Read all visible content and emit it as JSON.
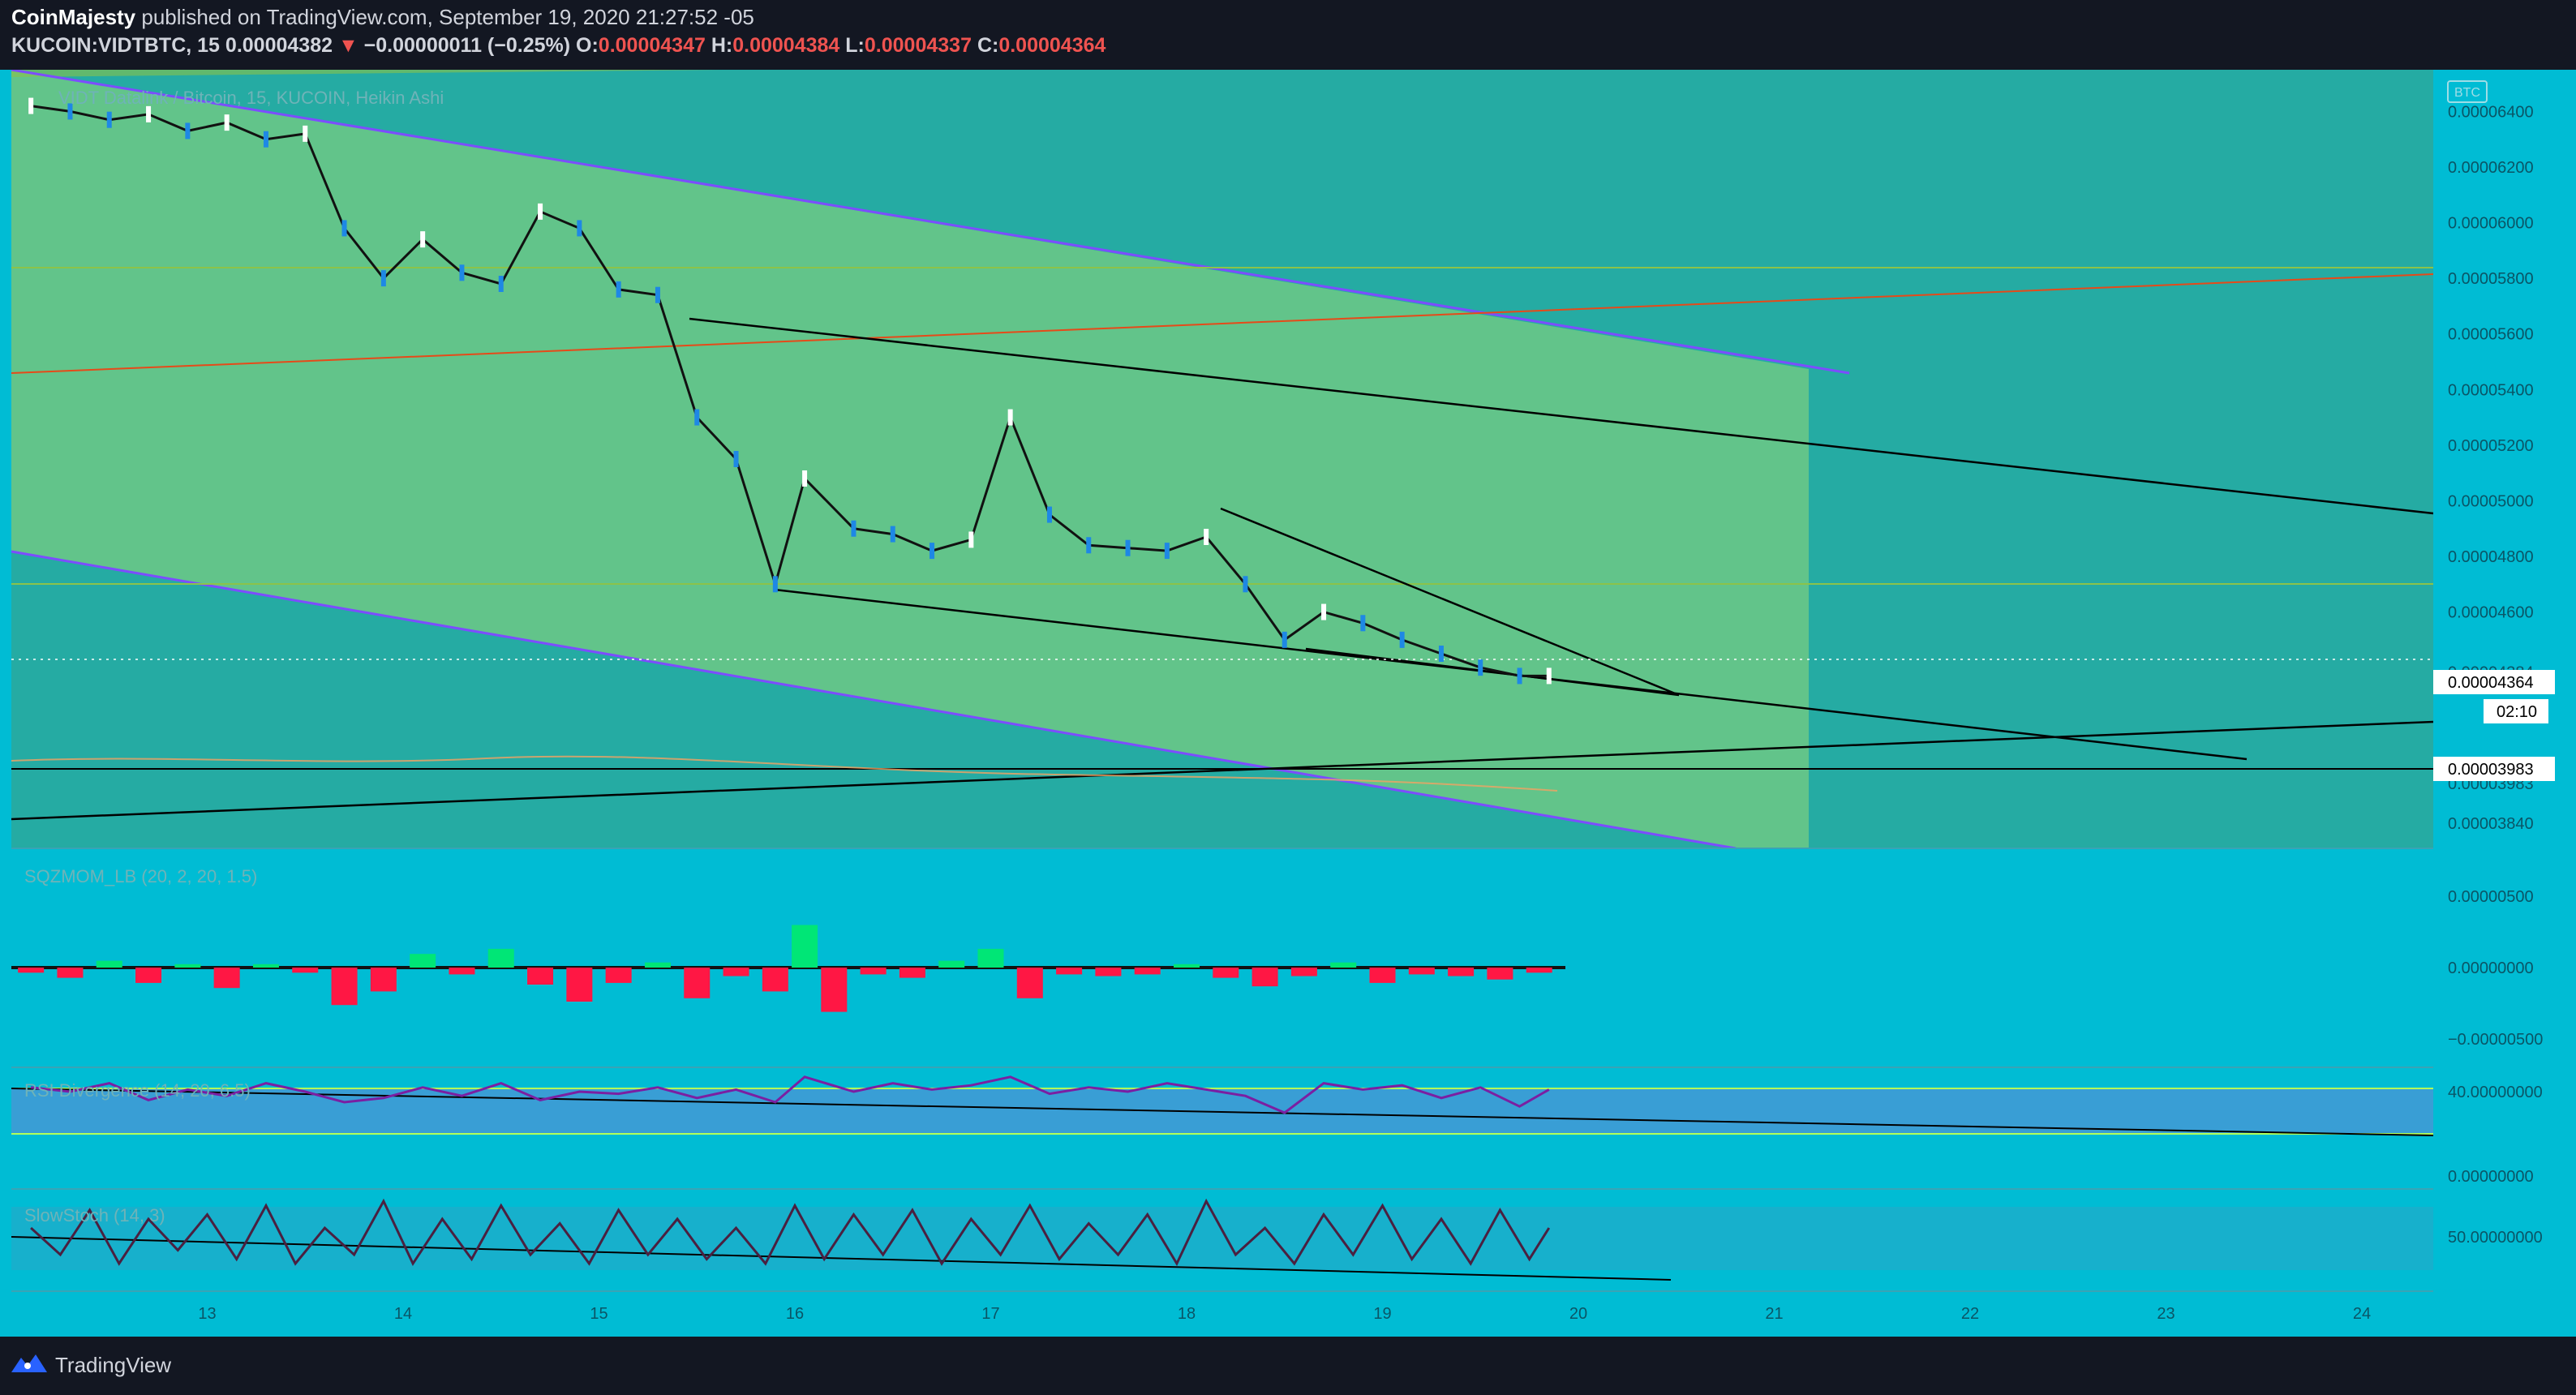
{
  "header": {
    "author": "CoinMajesty",
    "published_text": "published on TradingView.com, September 19, 2020 21:27:52 -05",
    "symbol": "KUCOIN:VIDTBTC, 15",
    "last": "0.00004382",
    "change": "−0.00000011 (−0.25%)",
    "open_label": "O:",
    "open": "0.00004347",
    "high_label": "H:",
    "high": "0.00004384",
    "low_label": "L:",
    "low": "0.00004337",
    "close_label": "C:",
    "close": "0.00004364"
  },
  "footer": {
    "brand": "TradingView"
  },
  "colors": {
    "background": "#131722",
    "chart_bg": "#00bcd4",
    "pane_bg": "#2fa8a8",
    "channel_fill": "#6ed67a",
    "up_candle": "#ffffff",
    "down_candle": "#1e88e5",
    "trend_line": "#000000",
    "squeeze_up": "#00e676",
    "squeeze_down": "#ff1744",
    "rsi_line": "#7b1fa2",
    "stoch_line": "#4a2040"
  },
  "chart_data": [
    {
      "type": "line",
      "pane": "price",
      "overlay_label": "VIDT Datalink / Bitcoin, 15, KUCOIN, Heikin Ashi",
      "currency_badge": "BTC",
      "x_ticks": [
        "13",
        "14",
        "15",
        "16",
        "17",
        "18",
        "19",
        "20",
        "21",
        "22",
        "23",
        "24"
      ],
      "y_ticks": [
        "0.00006400",
        "0.00006200",
        "0.00006000",
        "0.00005800",
        "0.00005600",
        "0.00005400",
        "0.00005200",
        "0.00005000",
        "0.00004800",
        "0.00004600",
        "0.00004384",
        "0.00004364",
        "0.00003983",
        "0.00003840"
      ],
      "ylim": [
        3.75e-05,
        6.55e-05
      ],
      "price_labels": [
        {
          "text": "0.00004384",
          "value": 4.384e-05
        },
        {
          "text": "0.00004364",
          "value": 4.364e-05
        },
        {
          "text": "0.00003983",
          "value": 3.983e-05
        }
      ],
      "countdown": "02:10",
      "series": [
        {
          "x": [
            12.1,
            12.3,
            12.5,
            12.7,
            12.9,
            13.1,
            13.3,
            13.5,
            13.7,
            13.9,
            14.1,
            14.3,
            14.5,
            14.7,
            14.9,
            15.1,
            15.3,
            15.5,
            15.7,
            15.9,
            16.05,
            16.3,
            16.5,
            16.7,
            16.9,
            17.1,
            17.3,
            17.5,
            17.7,
            17.9,
            18.1,
            18.3,
            18.5,
            18.7,
            18.9,
            19.1,
            19.3,
            19.5,
            19.7,
            19.85
          ],
          "y": [
            6.42e-05,
            6.4e-05,
            6.37e-05,
            6.39e-05,
            6.33e-05,
            6.36e-05,
            6.3e-05,
            6.32e-05,
            5.98e-05,
            5.8e-05,
            5.94e-05,
            5.82e-05,
            5.78e-05,
            6.04e-05,
            5.98e-05,
            5.76e-05,
            5.74e-05,
            5.3e-05,
            5.15e-05,
            4.7e-05,
            5.08e-05,
            4.9e-05,
            4.88e-05,
            4.82e-05,
            4.86e-05,
            5.3e-05,
            4.95e-05,
            4.84e-05,
            4.83e-05,
            4.82e-05,
            4.87e-05,
            4.7e-05,
            4.5e-05,
            4.6e-05,
            4.56e-05,
            4.5e-05,
            4.45e-05,
            4.4e-05,
            4.37e-05,
            4.37e-05
          ]
        }
      ]
    },
    {
      "type": "bar",
      "pane": "squeeze",
      "label": "SQZMOM_LB (20, 2, 20, 1.5)",
      "y_ticks": [
        "0.00000500",
        "0.00000000",
        "−0.00000500"
      ],
      "ylim": [
        -7.5e-06,
        7.5e-06
      ],
      "series": [
        {
          "x": [
            12.1,
            12.3,
            12.5,
            12.7,
            12.9,
            13.1,
            13.3,
            13.5,
            13.7,
            13.9,
            14.1,
            14.3,
            14.5,
            14.7,
            14.9,
            15.1,
            15.3,
            15.5,
            15.7,
            15.9,
            16.05,
            16.2,
            16.4,
            16.6,
            16.8,
            17.0,
            17.2,
            17.4,
            17.6,
            17.8,
            18.0,
            18.2,
            18.4,
            18.6,
            18.8,
            19.0,
            19.2,
            19.4,
            19.6,
            19.8
          ],
          "values": [
            -3e-07,
            -6e-07,
            4e-07,
            -9e-07,
            2e-07,
            -1.2e-06,
            2e-07,
            -3e-07,
            -2.2e-06,
            -1.4e-06,
            8e-07,
            -4e-07,
            1.1e-06,
            -1e-06,
            -2e-06,
            -9e-07,
            3e-07,
            -1.8e-06,
            -5e-07,
            -1.4e-06,
            2.5e-06,
            -2.6e-06,
            -4e-07,
            -6e-07,
            4e-07,
            1.1e-06,
            -1.8e-06,
            -4e-07,
            -5e-07,
            -4e-07,
            2e-07,
            -6e-07,
            -1.1e-06,
            -5e-07,
            3e-07,
            -9e-07,
            -4e-07,
            -5e-07,
            -7e-07,
            -3e-07
          ]
        }
      ]
    },
    {
      "type": "line",
      "pane": "rsi",
      "label": "RSI Divergence (14, 20, 6.5)",
      "y_ticks": [
        "40.00000000",
        "0.00000000"
      ],
      "series": [
        {
          "x": [
            12.1,
            12.3,
            12.5,
            12.7,
            12.9,
            13.1,
            13.3,
            13.5,
            13.7,
            13.9,
            14.1,
            14.3,
            14.5,
            14.7,
            14.9,
            15.1,
            15.3,
            15.5,
            15.7,
            15.9,
            16.05,
            16.3,
            16.5,
            16.7,
            16.9,
            17.1,
            17.3,
            17.5,
            17.7,
            17.9,
            18.1,
            18.3,
            18.5,
            18.7,
            18.9,
            19.1,
            19.3,
            19.5,
            19.7,
            19.85
          ],
          "y": [
            42,
            40,
            44,
            36,
            41,
            38,
            44,
            40,
            35,
            37,
            42,
            38,
            44,
            36,
            40,
            39,
            42,
            37,
            41,
            35,
            47,
            40,
            44,
            41,
            43,
            47,
            39,
            42,
            40,
            44,
            41,
            38,
            30,
            44,
            41,
            43,
            37,
            42,
            33,
            41
          ]
        }
      ]
    },
    {
      "type": "line",
      "pane": "stoch",
      "label": "SlowStoch (14, 3)",
      "y_ticks": [
        "50.00000000"
      ],
      "series": [
        {
          "x": [
            12.1,
            12.25,
            12.4,
            12.55,
            12.7,
            12.85,
            13.0,
            13.15,
            13.3,
            13.45,
            13.6,
            13.75,
            13.9,
            14.05,
            14.2,
            14.35,
            14.5,
            14.65,
            14.8,
            14.95,
            15.1,
            15.25,
            15.4,
            15.55,
            15.7,
            15.85,
            16.0,
            16.15,
            16.3,
            16.45,
            16.6,
            16.75,
            16.9,
            17.05,
            17.2,
            17.35,
            17.5,
            17.65,
            17.8,
            17.95,
            18.1,
            18.25,
            18.4,
            18.55,
            18.7,
            18.85,
            19.0,
            19.15,
            19.3,
            19.45,
            19.6,
            19.75,
            19.85
          ],
          "y": [
            60,
            30,
            80,
            20,
            70,
            35,
            75,
            25,
            85,
            20,
            60,
            30,
            90,
            20,
            70,
            25,
            85,
            30,
            65,
            20,
            80,
            30,
            70,
            25,
            60,
            20,
            85,
            25,
            75,
            30,
            80,
            20,
            70,
            30,
            85,
            25,
            65,
            30,
            75,
            20,
            90,
            30,
            60,
            20,
            75,
            30,
            85,
            25,
            70,
            20,
            80,
            25,
            60
          ]
        }
      ]
    }
  ]
}
